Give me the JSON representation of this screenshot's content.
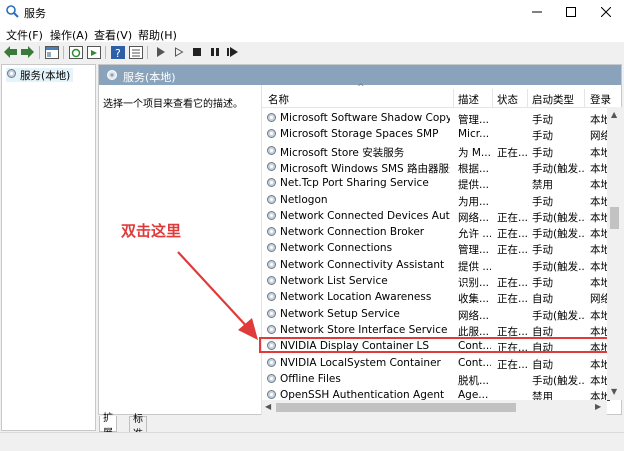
{
  "window": {
    "title": "服务",
    "min_icon": "minimize-icon",
    "max_icon": "maximize-icon",
    "close_icon": "close-icon"
  },
  "menu": [
    "文件(F)",
    "操作(A)",
    "查看(V)",
    "帮助(H)"
  ],
  "toolbar": [
    "back-arrow-icon",
    "forward-arrow-icon",
    "show-tree-icon",
    "refresh-icon",
    "export-icon",
    "help-icon",
    "properties-icon",
    "play-icon",
    "play-outline-icon",
    "stop-icon",
    "pause-icon",
    "restart-icon"
  ],
  "tree": {
    "item": "服务(本地)"
  },
  "panel": {
    "title": "服务(本地)",
    "description": "选择一个项目来查看它的描述。"
  },
  "columns": [
    "名称",
    "描述",
    "状态",
    "启动类型",
    "登录"
  ],
  "services": [
    {
      "name": "Microsoft Software Shadow Copy Provider",
      "desc": "管理...",
      "status": "",
      "startup": "手动",
      "logon": "本地"
    },
    {
      "name": "Microsoft Storage Spaces SMP",
      "desc": "Micr...",
      "status": "",
      "startup": "手动",
      "logon": "网络"
    },
    {
      "name": "Microsoft Store 安装服务",
      "desc": "为 M...",
      "status": "正在...",
      "startup": "手动",
      "logon": "本地"
    },
    {
      "name": "Microsoft Windows SMS 路由器服务。",
      "desc": "根据...",
      "status": "",
      "startup": "手动(触发...",
      "logon": "本地"
    },
    {
      "name": "Net.Tcp Port Sharing Service",
      "desc": "提供...",
      "status": "",
      "startup": "禁用",
      "logon": "本地"
    },
    {
      "name": "Netlogon",
      "desc": "为用...",
      "status": "",
      "startup": "手动",
      "logon": "本地"
    },
    {
      "name": "Network Connected Devices Auto-Setup",
      "desc": "网络...",
      "status": "正在...",
      "startup": "手动(触发...",
      "logon": "本地"
    },
    {
      "name": "Network Connection Broker",
      "desc": "允许 ...",
      "status": "正在...",
      "startup": "手动(触发...",
      "logon": "本地"
    },
    {
      "name": "Network Connections",
      "desc": "管理...",
      "status": "正在...",
      "startup": "手动",
      "logon": "本地"
    },
    {
      "name": "Network Connectivity Assistant",
      "desc": "提供 ...",
      "status": "",
      "startup": "手动(触发...",
      "logon": "本地"
    },
    {
      "name": "Network List Service",
      "desc": "识别...",
      "status": "正在...",
      "startup": "手动",
      "logon": "本地"
    },
    {
      "name": "Network Location Awareness",
      "desc": "收集...",
      "status": "正在...",
      "startup": "自动",
      "logon": "网络"
    },
    {
      "name": "Network Setup Service",
      "desc": "网络...",
      "status": "",
      "startup": "手动(触发...",
      "logon": "本地"
    },
    {
      "name": "Network Store Interface Service",
      "desc": "此服...",
      "status": "正在...",
      "startup": "自动",
      "logon": "本地"
    },
    {
      "name": "NVIDIA Display Container LS",
      "desc": "Cont...",
      "status": "正在...",
      "startup": "自动",
      "logon": "本地"
    },
    {
      "name": "NVIDIA LocalSystem Container",
      "desc": "Cont...",
      "status": "正在...",
      "startup": "自动",
      "logon": "本地"
    },
    {
      "name": "Offline Files",
      "desc": "脱机...",
      "status": "",
      "startup": "手动(触发...",
      "logon": "本地"
    },
    {
      "name": "OpenSSH Authentication Agent",
      "desc": "Age...",
      "status": "",
      "startup": "禁用",
      "logon": "本地"
    }
  ],
  "highlight_index": 14,
  "tabs": [
    "扩展",
    "标准"
  ],
  "annotation": {
    "text": "双击这里",
    "color": "#e03b3b"
  },
  "colors": {
    "header": "#8aa3bd",
    "highlight_border": "#e03b3b"
  }
}
